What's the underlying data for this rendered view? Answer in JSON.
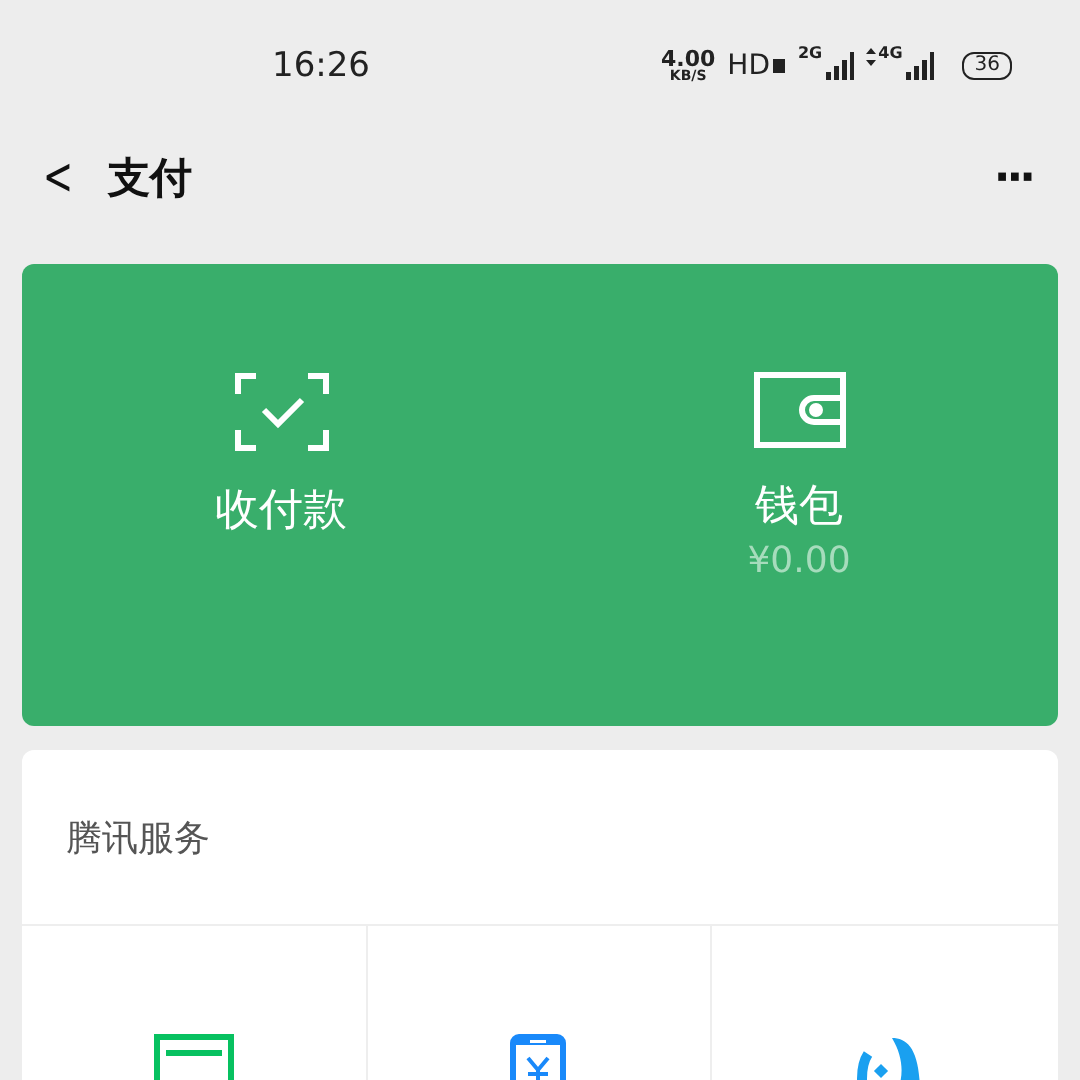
{
  "status_bar": {
    "time": "16:26",
    "speed_value": "4.00",
    "speed_unit": "KB/S",
    "hd": "HD",
    "sim1_network": "2G",
    "sim2_network": "4G",
    "battery": "36"
  },
  "header": {
    "back": "<",
    "title": "支付",
    "more": "···"
  },
  "pay_card": {
    "actions": [
      {
        "kind": "scan",
        "label": "收付款"
      },
      {
        "kind": "wallet",
        "label": "钱包",
        "amount": "¥0.00"
      }
    ]
  },
  "services": {
    "title": "腾讯服务",
    "items": [
      {
        "kind": "card"
      },
      {
        "kind": "phone"
      },
      {
        "kind": "drop"
      }
    ]
  }
}
